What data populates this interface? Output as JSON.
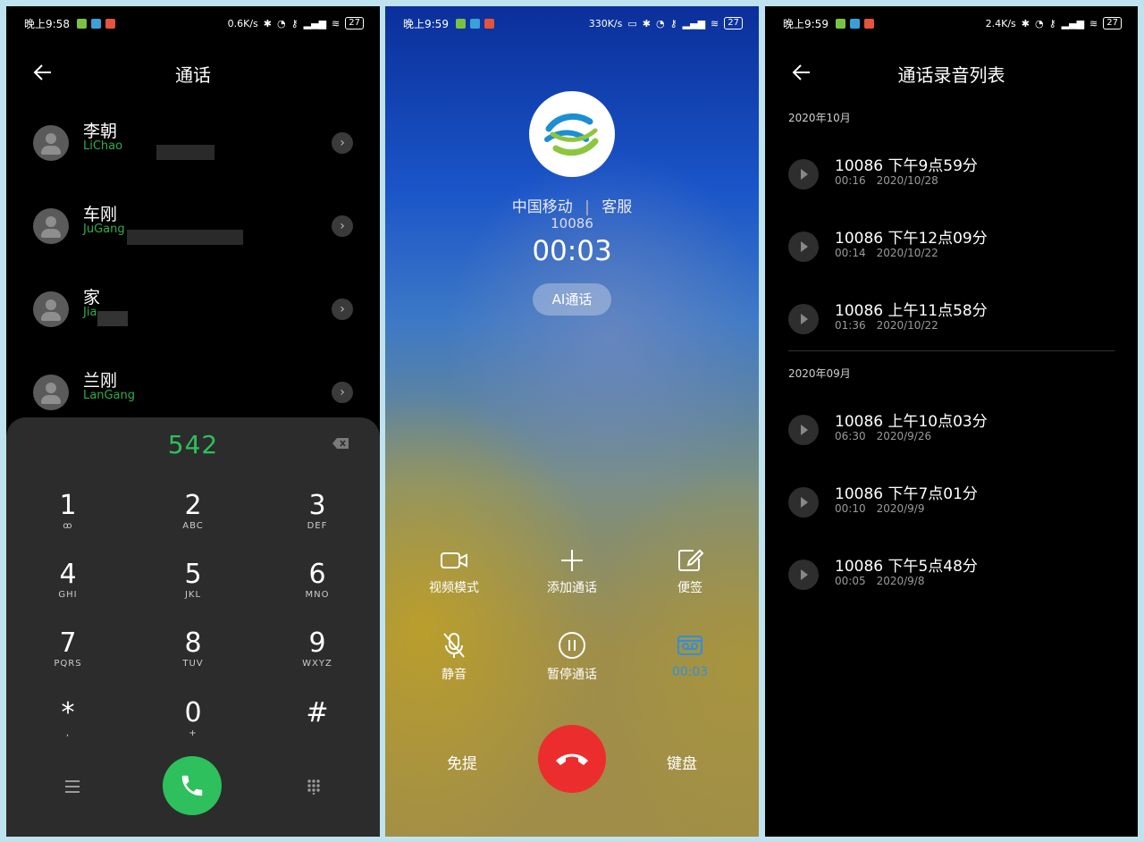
{
  "status": {
    "left": {
      "time": "晚上9:58",
      "speed": "0.6K/s",
      "battery": "27"
    },
    "mid": {
      "time": "晚上9:59",
      "speed": "330K/s",
      "battery": "27"
    },
    "right": {
      "time": "晚上9:59",
      "speed": "2.4K/s",
      "battery": "27"
    }
  },
  "dialer": {
    "title": "通话",
    "contacts": [
      {
        "name": "李朝",
        "pinyin": "LiChao"
      },
      {
        "name": "车刚",
        "pinyin": "JuGang"
      },
      {
        "name": "家",
        "pinyin": "Jia"
      },
      {
        "name": "兰刚",
        "pinyin": "LanGang"
      }
    ],
    "dialed_number": "542",
    "keys": [
      {
        "digit": "1",
        "letters": "ꝏ"
      },
      {
        "digit": "2",
        "letters": "ABC"
      },
      {
        "digit": "3",
        "letters": "DEF"
      },
      {
        "digit": "4",
        "letters": "GHI"
      },
      {
        "digit": "5",
        "letters": "JKL"
      },
      {
        "digit": "6",
        "letters": "MNO"
      },
      {
        "digit": "7",
        "letters": "PQRS"
      },
      {
        "digit": "8",
        "letters": "TUV"
      },
      {
        "digit": "9",
        "letters": "WXYZ"
      },
      {
        "digit": "*",
        "letters": ","
      },
      {
        "digit": "0",
        "letters": "+"
      },
      {
        "digit": "#",
        "letters": ""
      }
    ],
    "icons": {
      "menu": "menu-icon",
      "call": "phone-icon",
      "keypad": "keypad-icon"
    }
  },
  "in_call": {
    "carrier": "中国移动",
    "separator": "|",
    "label": "客服",
    "number": "10086",
    "duration": "00:03",
    "ai_label": "AI通话",
    "actions": [
      {
        "label": "视频模式",
        "icon": "video-icon"
      },
      {
        "label": "添加通话",
        "icon": "plus-icon"
      },
      {
        "label": "便签",
        "icon": "note-icon"
      },
      {
        "label": "静音",
        "icon": "mic-off-icon"
      },
      {
        "label": "暂停通话",
        "icon": "pause-icon"
      },
      {
        "label": "00:03",
        "icon": "record-icon"
      }
    ],
    "speaker_label": "免提",
    "keypad_label": "键盘",
    "record_color": "#2f8fe0",
    "hangup_color": "#ec2d2d"
  },
  "recordings": {
    "title": "通话录音列表",
    "groups": [
      {
        "month": "2020年10月",
        "items": [
          {
            "title": "10086 下午9点59分",
            "duration": "00:16",
            "date": "2020/10/28"
          },
          {
            "title": "10086 下午12点09分",
            "duration": "00:14",
            "date": "2020/10/22"
          },
          {
            "title": "10086 上午11点58分",
            "duration": "01:36",
            "date": "2020/10/22"
          }
        ]
      },
      {
        "month": "2020年09月",
        "items": [
          {
            "title": "10086 上午10点03分",
            "duration": "06:30",
            "date": "2020/9/26"
          },
          {
            "title": "10086 下午7点01分",
            "duration": "00:10",
            "date": "2020/9/9"
          },
          {
            "title": "10086 下午5点48分",
            "duration": "00:05",
            "date": "2020/9/8"
          }
        ]
      }
    ]
  }
}
